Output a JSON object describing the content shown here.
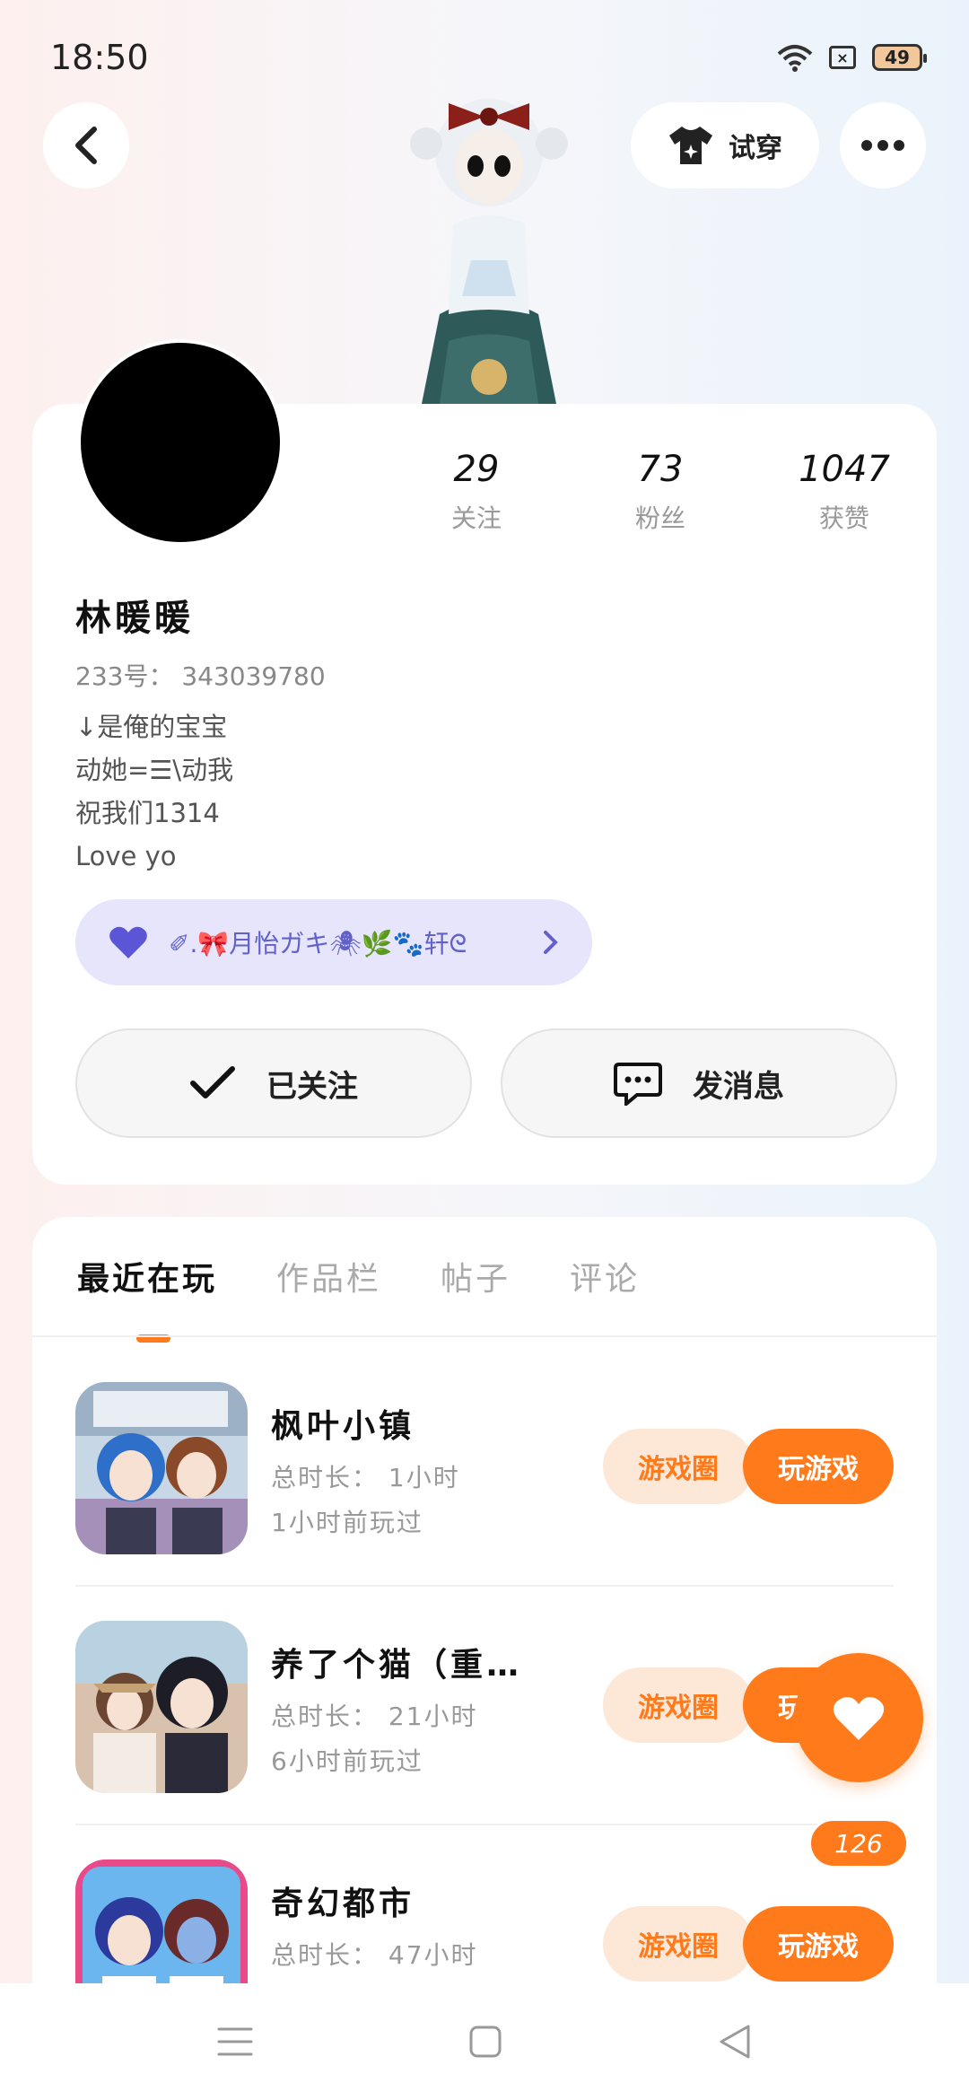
{
  "status": {
    "time": "18:50",
    "battery": "49"
  },
  "header": {
    "tryon_label": "试穿"
  },
  "profile": {
    "stats": [
      {
        "num": "29",
        "label": "关注"
      },
      {
        "num": "73",
        "label": "粉丝"
      },
      {
        "num": "1047",
        "label": "获赞"
      }
    ],
    "username": "林暖暖",
    "uid": "233号： 343039780",
    "bio": [
      "↓是俺的宝宝",
      "动她=☰\\动我",
      "祝我们1314",
      "Love yo"
    ],
    "group_name": "✐.🎀月怡ガキ🕷🌿🐾轩ᘓ",
    "followed_label": "已关注",
    "message_label": "发消息"
  },
  "tabs": [
    {
      "label": "最近在玩"
    },
    {
      "label": "作品栏"
    },
    {
      "label": "帖子"
    },
    {
      "label": "评论"
    }
  ],
  "games": [
    {
      "name": "枫叶小镇",
      "duration": "总时长： 1小时",
      "last_played": "1小时前玩过",
      "circle_label": "游戏圈",
      "play_label": "玩游戏"
    },
    {
      "name": "养了个猫（重…",
      "duration": "总时长： 21小时",
      "last_played": "6小时前玩过",
      "circle_label": "游戏圈",
      "play_label": "玩游戏"
    },
    {
      "name": "奇幻都市",
      "duration": "总时长： 47小时",
      "last_played": "",
      "circle_label": "游戏圈",
      "play_label": "玩游戏"
    }
  ],
  "fab": {
    "count": "126"
  },
  "colors": {
    "accent": "#ff7a1a",
    "accent_light": "#fde7d7",
    "pill_bg": "#e6e5fb",
    "pill_text": "#6161c9"
  }
}
